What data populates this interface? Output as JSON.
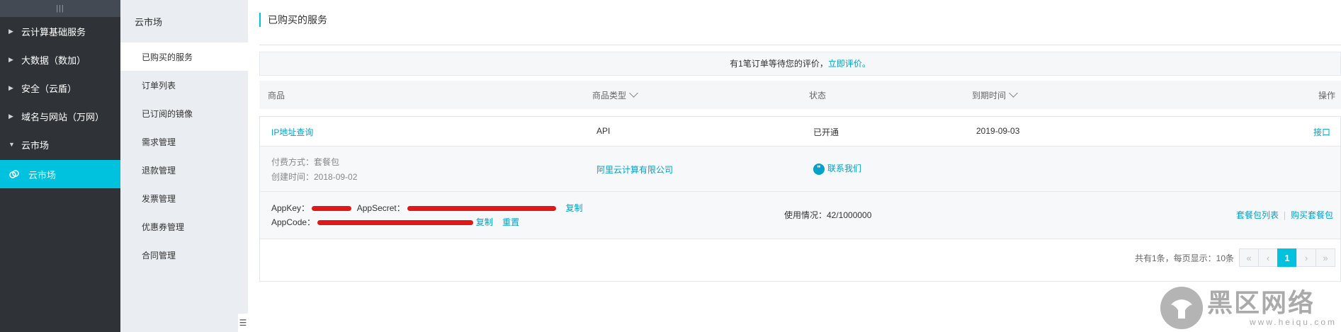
{
  "sidebar": {
    "top_label": "|||",
    "items": [
      {
        "label": "云计算基础服务",
        "expanded": false
      },
      {
        "label": "大数据（数加）",
        "expanded": false
      },
      {
        "label": "安全（云盾）",
        "expanded": false
      },
      {
        "label": "域名与网站（万网）",
        "expanded": false
      },
      {
        "label": "云市场",
        "expanded": true
      }
    ],
    "active_item": {
      "label": "云市场"
    }
  },
  "subnav": {
    "title": "云市场",
    "items": [
      {
        "label": "已购买的服务"
      },
      {
        "label": "订单列表"
      },
      {
        "label": "已订阅的镜像"
      },
      {
        "label": "需求管理"
      },
      {
        "label": "退款管理"
      },
      {
        "label": "发票管理"
      },
      {
        "label": "优惠券管理"
      },
      {
        "label": "合同管理"
      }
    ],
    "collapse_icon": "☰"
  },
  "page": {
    "title": "已购买的服务"
  },
  "notice": {
    "text": "有1笔订单等待您的评价，",
    "link": "立即评价。"
  },
  "table": {
    "headers": {
      "product": "商品",
      "product_type": "商品类型",
      "status": "状态",
      "expiry": "到期时间",
      "actions": "操作"
    }
  },
  "order": {
    "product_name": "IP地址查询",
    "type": "API",
    "status": "已开通",
    "expiry": "2019-09-03",
    "action": "接口",
    "payment": "付费方式：套餐包",
    "created": "创建时间：2018-09-02",
    "vendor": "阿里云计算有限公司",
    "contact": "联系我们",
    "appkey_label": "AppKey：",
    "appsecret_label": "AppSecret：",
    "appcode_label": "AppCode：",
    "copy": "复制",
    "reset": "重置",
    "usage": "使用情况：42/1000000",
    "package_list": "套餐包列表",
    "buy_package": "购买套餐包"
  },
  "pagination": {
    "summary": "共有1条，每页显示：10条",
    "first": "«",
    "prev": "‹",
    "current": "1",
    "next": "›",
    "last": "»"
  },
  "watermark": {
    "cn": "黑区网络",
    "en": "www.heiqu.com"
  },
  "colors": {
    "accent": "#00c1de",
    "link": "#00a2ca",
    "sidebar": "#2f3338",
    "subnav": "#eaedf1",
    "redaction": "#e01818"
  }
}
